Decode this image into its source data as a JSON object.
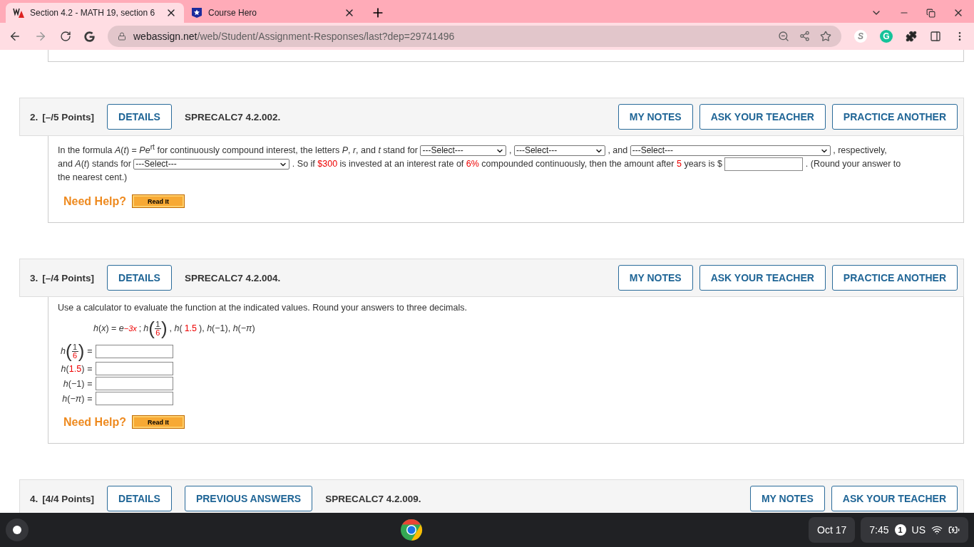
{
  "browser": {
    "tabs": [
      {
        "title": "Section 4.2 - MATH 19, section 6",
        "selected": true,
        "kind": "wa"
      },
      {
        "title": "Course Hero",
        "selected": false,
        "kind": "ch"
      }
    ],
    "url_host": "webassign.net",
    "url_path": "/web/Student/Assignment-Responses/last?dep=29741496",
    "extensions": [
      {
        "kind": "s",
        "glyph": "S"
      },
      {
        "kind": "g",
        "glyph": "G"
      }
    ]
  },
  "questions": [
    {
      "number": "2.",
      "points": "[–/5 Points]",
      "left_buttons": [
        "DETAILS"
      ],
      "code": "SPRECALC7 4.2.002.",
      "right_buttons": [
        "MY NOTES",
        "ASK YOUR TEACHER",
        "PRACTICE ANOTHER"
      ],
      "body": {
        "kind": "fill",
        "segments": [
          {
            "kind": "text",
            "text": "In the formula  *A*(*t*) = *Pe*$^{rt}$  for continuously compound interest, the letters *P*, *r*, and *t* stand for"
          },
          {
            "kind": "select",
            "text": "---Select---"
          },
          {
            "kind": "text",
            "text": ","
          },
          {
            "kind": "select",
            "text": "---Select---"
          },
          {
            "kind": "text",
            "text": ", and"
          },
          {
            "kind": "select",
            "text": "---Select---"
          },
          {
            "kind": "text",
            "text": ", respectively,"
          },
          {
            "kind": "text",
            "text": "and *A*(*t*) stands for"
          },
          {
            "kind": "select",
            "text": "---Select---"
          },
          {
            "kind": "text",
            "text": ". So if"
          },
          {
            "kind": "value",
            "text": "$300"
          },
          {
            "kind": "text",
            "text": "is invested at an interest rate of"
          },
          {
            "kind": "value",
            "text": "6%"
          },
          {
            "kind": "text",
            "text": "compounded continuously, then the amount after"
          },
          {
            "kind": "value",
            "text": "5"
          },
          {
            "kind": "text",
            "text": "years is $"
          },
          {
            "kind": "input"
          },
          {
            "kind": "text",
            "text": ". (Round your answer to"
          },
          {
            "kind": "text",
            "text": "the nearest cent.)"
          }
        ],
        "help": "Need Help?",
        "help_button": "Read It"
      }
    },
    {
      "number": "3.",
      "points": "[–/4 Points]",
      "left_buttons": [
        "DETAILS"
      ],
      "code": "SPRECALC7 4.2.004.",
      "right_buttons": [
        "MY NOTES",
        "ASK YOUR TEACHER",
        "PRACTICE ANOTHER"
      ],
      "body": {
        "kind": "evaluate",
        "intro": "Use a calculator to evaluate the function at the indicated values. Round your answers to three decimals.",
        "formula": [
          {
            "kind": "math",
            "text": "*h*(*x*) = *e*"
          },
          {
            "kind": "sup",
            "text": "−3x"
          },
          {
            "kind": "math",
            "text": ";"
          },
          {
            "kind": "frac",
            "fn": "h",
            "open": "(",
            "num": "1",
            "den": "6",
            "close": ")"
          },
          {
            "kind": "math",
            "text": ", *h*("
          },
          {
            "kind": "value",
            "text": "1.5"
          },
          {
            "kind": "math",
            "text": "), *h*(−1), *h*(−*π*)"
          }
        ],
        "rows": [
          {
            "label": [
              {
                "kind": "frac",
                "fn": "h",
                "open": "(",
                "num": "1",
                "den": "6",
                "close": ")"
              }
            ],
            "equals": "="
          },
          {
            "label": [
              {
                "kind": "var",
                "text": "h"
              },
              {
                "kind": "math",
                "text": "("
              },
              {
                "kind": "value",
                "text": "1.5"
              },
              {
                "kind": "math",
                "text": ")"
              }
            ],
            "equals": "="
          },
          {
            "label": [
              {
                "kind": "math",
                "text": "*h*(−1)"
              }
            ],
            "equals": "="
          },
          {
            "label": [
              {
                "kind": "math",
                "text": "*h*(−*π*)"
              }
            ],
            "equals": "="
          }
        ],
        "help": "Need Help?",
        "help_button": "Read It"
      }
    },
    {
      "number": "4.",
      "points": "[4/4 Points]",
      "left_buttons": [
        "DETAILS",
        "PREVIOUS ANSWERS"
      ],
      "code": "SPRECALC7 4.2.009.",
      "right_buttons": [
        "MY NOTES",
        "ASK YOUR TEACHER"
      ]
    }
  ],
  "taskbar": {
    "date": "Oct 17",
    "time": "7:45",
    "notifications": "1",
    "keyboard": "US"
  }
}
